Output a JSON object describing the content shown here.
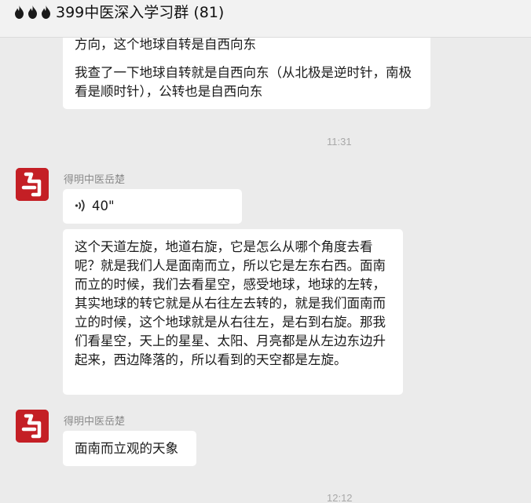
{
  "header": {
    "title": "399中医深入学习群",
    "member_count": "(81)"
  },
  "messages": {
    "m1": {
      "clipped_line": "方向，这个地球自转是自西向东",
      "text": "我查了一下地球自转就是自西向东（从北极是逆时针，南极看是顺时针），公转也是自西向东"
    },
    "ts1": "11:31",
    "m2": {
      "sender": "得明中医岳楚",
      "voice_duration": "40\"",
      "text": "这个天道左旋，地道右旋，它是怎么从哪个角度去看呢？就是我们人是面南而立，所以它是左东右西。面南而立的时候，我们去看星空，感受地球，地球的左转，其实地球的转它就是从右往左去转的，就是我们面南而立的时候，这个地球就是从右往左，是右到右旋。那我们看星空，天上的星星、太阳、月亮都是从左边东边升起来，西边降落的，所以看到的天空都是左旋。"
    },
    "m3": {
      "sender": "得明中医岳楚",
      "text": "面南而立观的天象"
    },
    "ts2": "12:12"
  },
  "colors": {
    "avatar_red": "#c41f25",
    "bubble": "#ffffff",
    "background": "#ebebeb"
  },
  "icons": [
    "flame-icon",
    "voice-wave-icon",
    "avatar-logo"
  ]
}
